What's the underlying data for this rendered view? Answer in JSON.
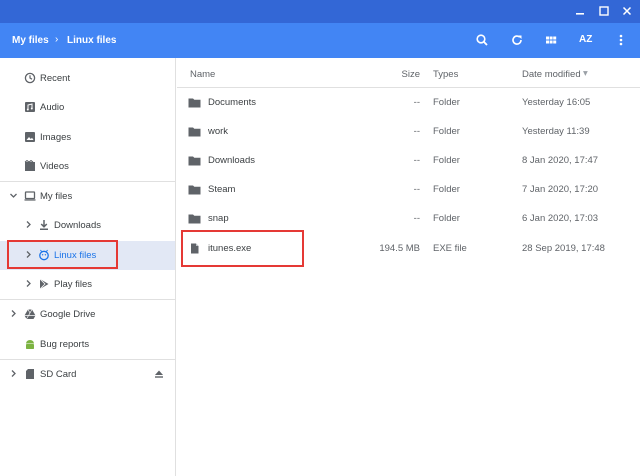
{
  "window": {
    "minimize": "minimize",
    "maximize": "maximize",
    "close": "close"
  },
  "breadcrumb": {
    "root": "My files",
    "separator": "›",
    "current": "Linux files"
  },
  "toolbar": {
    "icons": [
      "search-icon",
      "refresh-icon",
      "grid-view-icon",
      "sort-az-icon",
      "more-vert-icon"
    ],
    "sort_label": "AZ"
  },
  "sidebar": {
    "items": [
      {
        "label": "Recent",
        "icon": "clock-icon"
      },
      {
        "label": "Audio",
        "icon": "audio-icon"
      },
      {
        "label": "Images",
        "icon": "image-icon"
      },
      {
        "label": "Videos",
        "icon": "video-icon"
      },
      {
        "label": "My files",
        "icon": "computer-icon",
        "expanded": true
      },
      {
        "label": "Downloads",
        "icon": "download-icon"
      },
      {
        "label": "Linux files",
        "icon": "linux-icon",
        "active": true
      },
      {
        "label": "Play files",
        "icon": "play-icon"
      },
      {
        "label": "Google Drive",
        "icon": "drive-icon"
      },
      {
        "label": "Bug reports",
        "icon": "android-icon"
      },
      {
        "label": "SD Card",
        "icon": "sd-card-icon",
        "eject": true
      }
    ]
  },
  "columns": {
    "name": "Name",
    "size": "Size",
    "type": "Types",
    "date": "Date modified",
    "sort_indicator": "▾"
  },
  "files": [
    {
      "name": "Documents",
      "size": "--",
      "type": "Folder",
      "date": "Yesterday 16:05",
      "icon": "folder-icon"
    },
    {
      "name": "work",
      "size": "--",
      "type": "Folder",
      "date": "Yesterday 11:39",
      "icon": "folder-icon"
    },
    {
      "name": "Downloads",
      "size": "--",
      "type": "Folder",
      "date": "8 Jan 2020, 17:47",
      "icon": "folder-icon"
    },
    {
      "name": "Steam",
      "size": "--",
      "type": "Folder",
      "date": "7 Jan 2020, 17:20",
      "icon": "folder-icon"
    },
    {
      "name": "snap",
      "size": "--",
      "type": "Folder",
      "date": "6 Jan 2020, 17:03",
      "icon": "folder-icon"
    },
    {
      "name": "itunes.exe",
      "size": "194.5 MB",
      "type": "EXE file",
      "date": "28 Sep 2019, 17:48",
      "icon": "file-icon"
    }
  ],
  "colors": {
    "titlebar": "#3367d6",
    "header": "#4285f4",
    "active_bg": "#e2e8f5",
    "highlight": "#e53935"
  }
}
